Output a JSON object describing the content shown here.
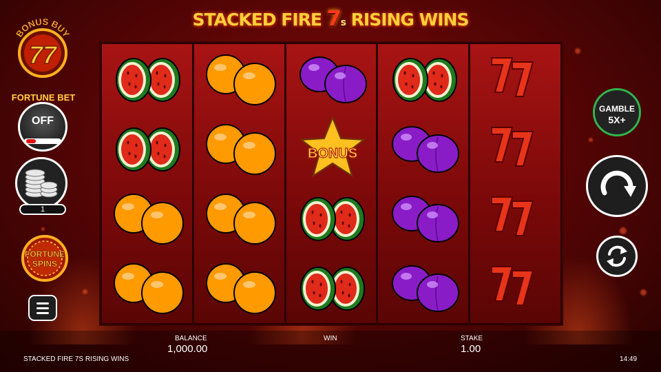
{
  "title": {
    "part1": "STACKED FIRE",
    "part2": "7",
    "part3": "s",
    "part4": "RISING WINS"
  },
  "left_panel": {
    "bonus_buy_label": "BONUS BUY",
    "bonus_buy_symbol": "77",
    "fortune_bet_label": "FORTUNE BET",
    "fortune_bet_state": "OFF",
    "coin_value": "1",
    "fortune_spins_label_line1": "FORTUNE",
    "fortune_spins_label_line2": "SPINS"
  },
  "right_panel": {
    "gamble_label": "GAMBLE",
    "gamble_multiplier": "5X+"
  },
  "reels": [
    [
      "watermelon",
      "watermelon",
      "orange",
      "orange"
    ],
    [
      "orange",
      "orange",
      "orange",
      "orange"
    ],
    [
      "plum",
      "bonus-star",
      "watermelon",
      "watermelon"
    ],
    [
      "watermelon",
      "plum",
      "plum",
      "plum"
    ],
    [
      "seven",
      "seven",
      "seven",
      "seven"
    ]
  ],
  "bonus_symbol_text": "BONUS",
  "bottom_bar": {
    "balance_label": "BALANCE",
    "balance_value": "1,000.00",
    "win_label": "WIN",
    "stake_label": "STAKE",
    "stake_value": "1.00",
    "game_name": "STACKED FIRE 7S RISING WINS",
    "clock": "14:49"
  },
  "colors": {
    "background": "#5a0505",
    "reel_background": "#8a0c0c",
    "gamble_ring": "#2fb54a",
    "accent_gold": "#ffcf3a"
  }
}
